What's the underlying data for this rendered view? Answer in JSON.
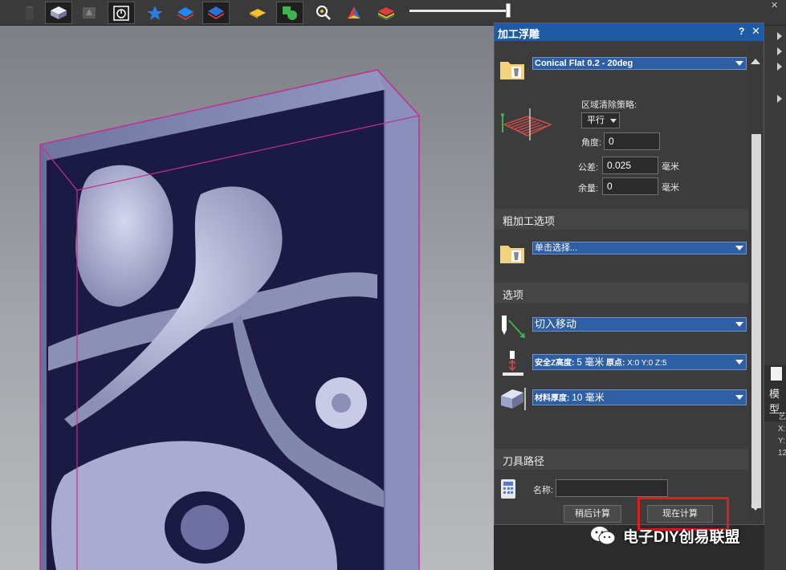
{
  "toolbar": {
    "icons": [
      "cylinder-icon",
      "model-icon",
      "relief-icon",
      "timer-icon",
      "star-icon",
      "layers-icon",
      "layer-stack-icon",
      "flat-layer-icon",
      "shapes-icon",
      "search-icon",
      "pyramid-icon",
      "color-layer-icon"
    ],
    "slider_value": 0.97
  },
  "panel": {
    "title": "加工浮雕",
    "help": "?",
    "close": "✕",
    "tool_dropdown": "Conical Flat 0.2 - 20deg",
    "strategy_label": "区域清除策略:",
    "strategy_value": "平行",
    "angle_label": "角度:",
    "angle_value": "0",
    "tolerance_label": "公差:",
    "tolerance_value": "0.025",
    "tolerance_unit": "毫米",
    "allowance_label": "余量:",
    "allowance_value": "0",
    "allowance_unit": "毫米",
    "roughing_section": "粗加工选项",
    "roughing_dropdown": "单击选择...",
    "options_section": "选项",
    "lead_in_dropdown": "切入移动",
    "safe_z_label": "安全Z高度:",
    "safe_z_value": "5 毫米",
    "origin_label": "原点:",
    "origin_value": "X:0 Y:0 Z:5",
    "material_label": "材料厚度:",
    "material_value": "10 毫米",
    "toolpath_section": "刀具路径",
    "name_label": "名称:",
    "name_value": "",
    "later_button": "稍后计算",
    "now_button": "现在计算"
  },
  "right_strip": {
    "tab_label": "模型",
    "info_lines": [
      "艺",
      "X:",
      "Y:",
      "12"
    ]
  },
  "watermark": {
    "text": "电子DIY创易联盟"
  },
  "colors": {
    "panel_header": "#1f5aa6",
    "dropdown": "#2e5fa5",
    "highlight": "#e21b1b",
    "model_edge": "#c0308f"
  }
}
